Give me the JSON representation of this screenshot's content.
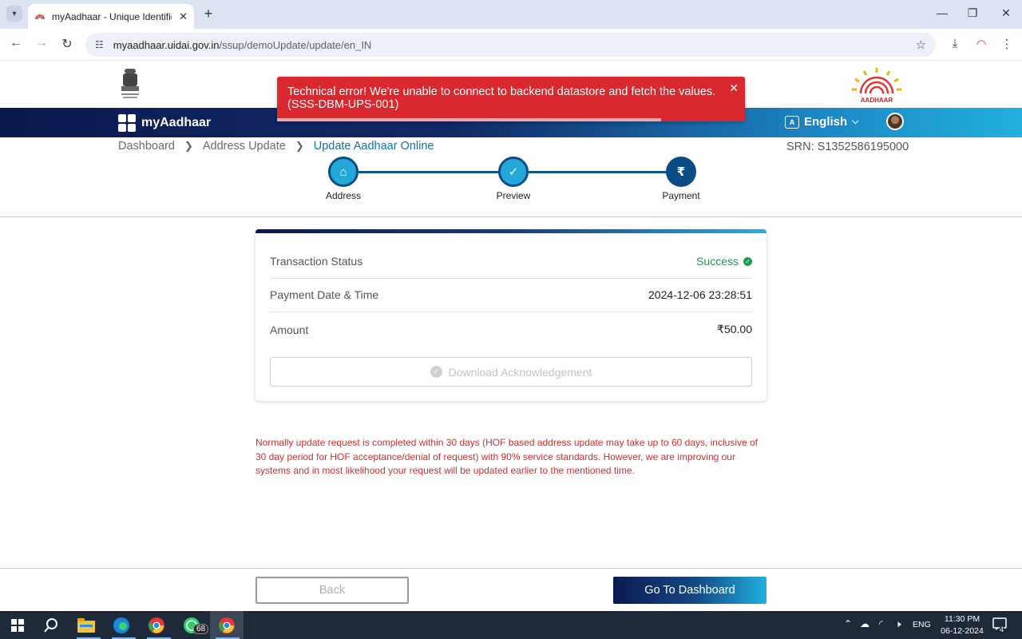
{
  "browser": {
    "tab_title": "myAadhaar - Unique Identificati",
    "url_host": "myaadhaar.uidai.gov.in",
    "url_path": "/ssup/demoUpdate/update/en_IN"
  },
  "site": {
    "emblem_text": "सत्यमेव जयते",
    "logo_text": "AADHAAR",
    "brand": "myAadhaar",
    "language": "English"
  },
  "toast": {
    "message": "Technical error! We're unable to connect to backend datastore and fetch the values. (SSS-DBM-UPS-001)",
    "progress_fraction": 0.82
  },
  "breadcrumb": {
    "items": [
      "Dashboard",
      "Address Update",
      "Update Aadhaar Online"
    ]
  },
  "srn": "SRN: S1352586195000",
  "steps": [
    {
      "label": "Address",
      "icon": "home-icon",
      "glyph": "⌂"
    },
    {
      "label": "Preview",
      "icon": "check-icon",
      "glyph": "✓"
    },
    {
      "label": "Payment",
      "icon": "rupee-icon",
      "glyph": "₹"
    }
  ],
  "transaction": {
    "status_label": "Transaction Status",
    "status_value": "Success",
    "date_label": "Payment Date & Time",
    "date_value": "2024-12-06 23:28:51",
    "amount_label": "Amount",
    "amount_value": "₹50.00",
    "download_label": "Download Acknowledgement"
  },
  "notice": "Normally update request is completed within 30 days (HOF based address update may take up to 60 days, inclusive of 30 day period for HOF acceptance/denial of request) with 90% service standards. However, we are improving our systems and in most likelihood your request will be updated earlier to the mentioned time.",
  "actions": {
    "back": "Back",
    "dashboard": "Go To Dashboard"
  },
  "taskbar": {
    "whatsapp_badge": "68",
    "lang": "ENG",
    "time": "11:30 PM",
    "date": "06-12-2024",
    "notif_count": "4"
  },
  "colors": {
    "toast": "#d9292f",
    "success": "#1e9a57",
    "navy": "#0b1a4f",
    "cyan": "#22b0e0"
  }
}
